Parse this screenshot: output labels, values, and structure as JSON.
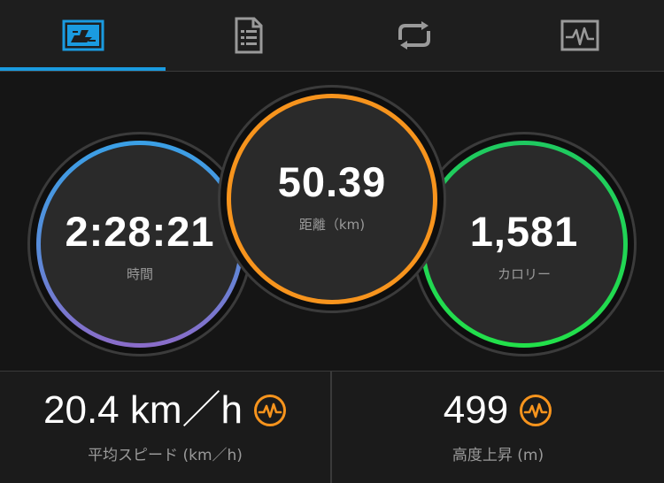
{
  "tabs": [
    {
      "icon": "speed-dashboard-icon",
      "active": true
    },
    {
      "icon": "document-list-icon",
      "active": false
    },
    {
      "icon": "loop-arrows-icon",
      "active": false
    },
    {
      "icon": "activity-chart-icon",
      "active": false
    }
  ],
  "metrics": {
    "time": {
      "value": "2:28:21",
      "label": "時間"
    },
    "distance": {
      "value": "50.39",
      "label": "距離（km)"
    },
    "calories": {
      "value": "1,581",
      "label": "カロリー"
    }
  },
  "stats": {
    "avg_speed": {
      "value": "20.4 km／h",
      "label": "平均スピード (km／h)",
      "icon": "pulse-icon"
    },
    "ascent": {
      "value": "499",
      "label": "高度上昇 (m)",
      "icon": "pulse-icon"
    }
  },
  "colors": {
    "accent": "#1a9be0",
    "orange": "#f7941d",
    "green": "#22e04a",
    "blue": "#3aa0e6",
    "purple": "#8b6cc9"
  }
}
